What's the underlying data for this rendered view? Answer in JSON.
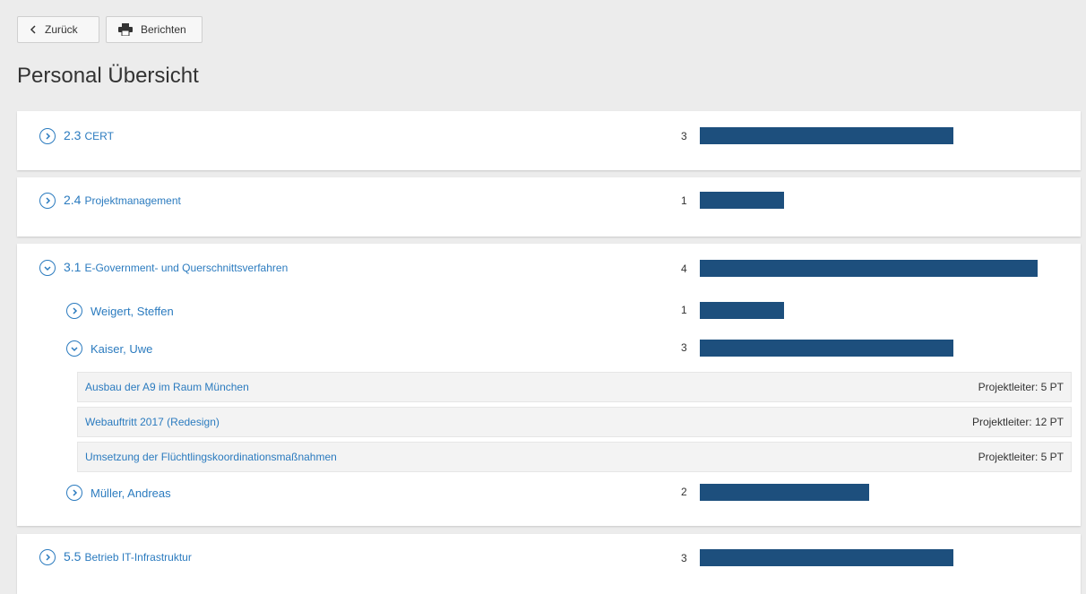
{
  "toolbar": {
    "back_label": "Zurück",
    "report_label": "Berichten"
  },
  "page_title": "Personal Übersicht",
  "scale_max": 4,
  "colors": {
    "link": "#2b7bbf",
    "bar": "#1d4f7d",
    "background": "#ececec"
  },
  "groups": [
    {
      "number": "2.3",
      "name": "CERT",
      "count": "3",
      "expanded": false
    },
    {
      "number": "2.4",
      "name": "Projektmanagement",
      "count": "1",
      "expanded": false
    },
    {
      "number": "3.1",
      "name": "E-Government- und Querschnittsverfahren",
      "count": "4",
      "expanded": true,
      "persons": [
        {
          "name": "Weigert, Steffen",
          "count": "1",
          "expanded": false
        },
        {
          "name": "Kaiser, Uwe",
          "count": "3",
          "expanded": true,
          "projects": [
            {
              "name": "Ausbau der A9 im Raum München",
              "role": "Projektleiter: 5 PT"
            },
            {
              "name": "Webauftritt 2017 (Redesign)",
              "role": "Projektleiter: 12 PT"
            },
            {
              "name": "Umsetzung der Flüchtlingskoordinationsmaßnahmen",
              "role": "Projektleiter: 5 PT"
            }
          ]
        },
        {
          "name": "Müller, Andreas",
          "count": "2",
          "expanded": false
        }
      ]
    },
    {
      "number": "5.5",
      "name": "Betrieb IT-Infrastruktur",
      "count": "3",
      "expanded": false
    }
  ]
}
